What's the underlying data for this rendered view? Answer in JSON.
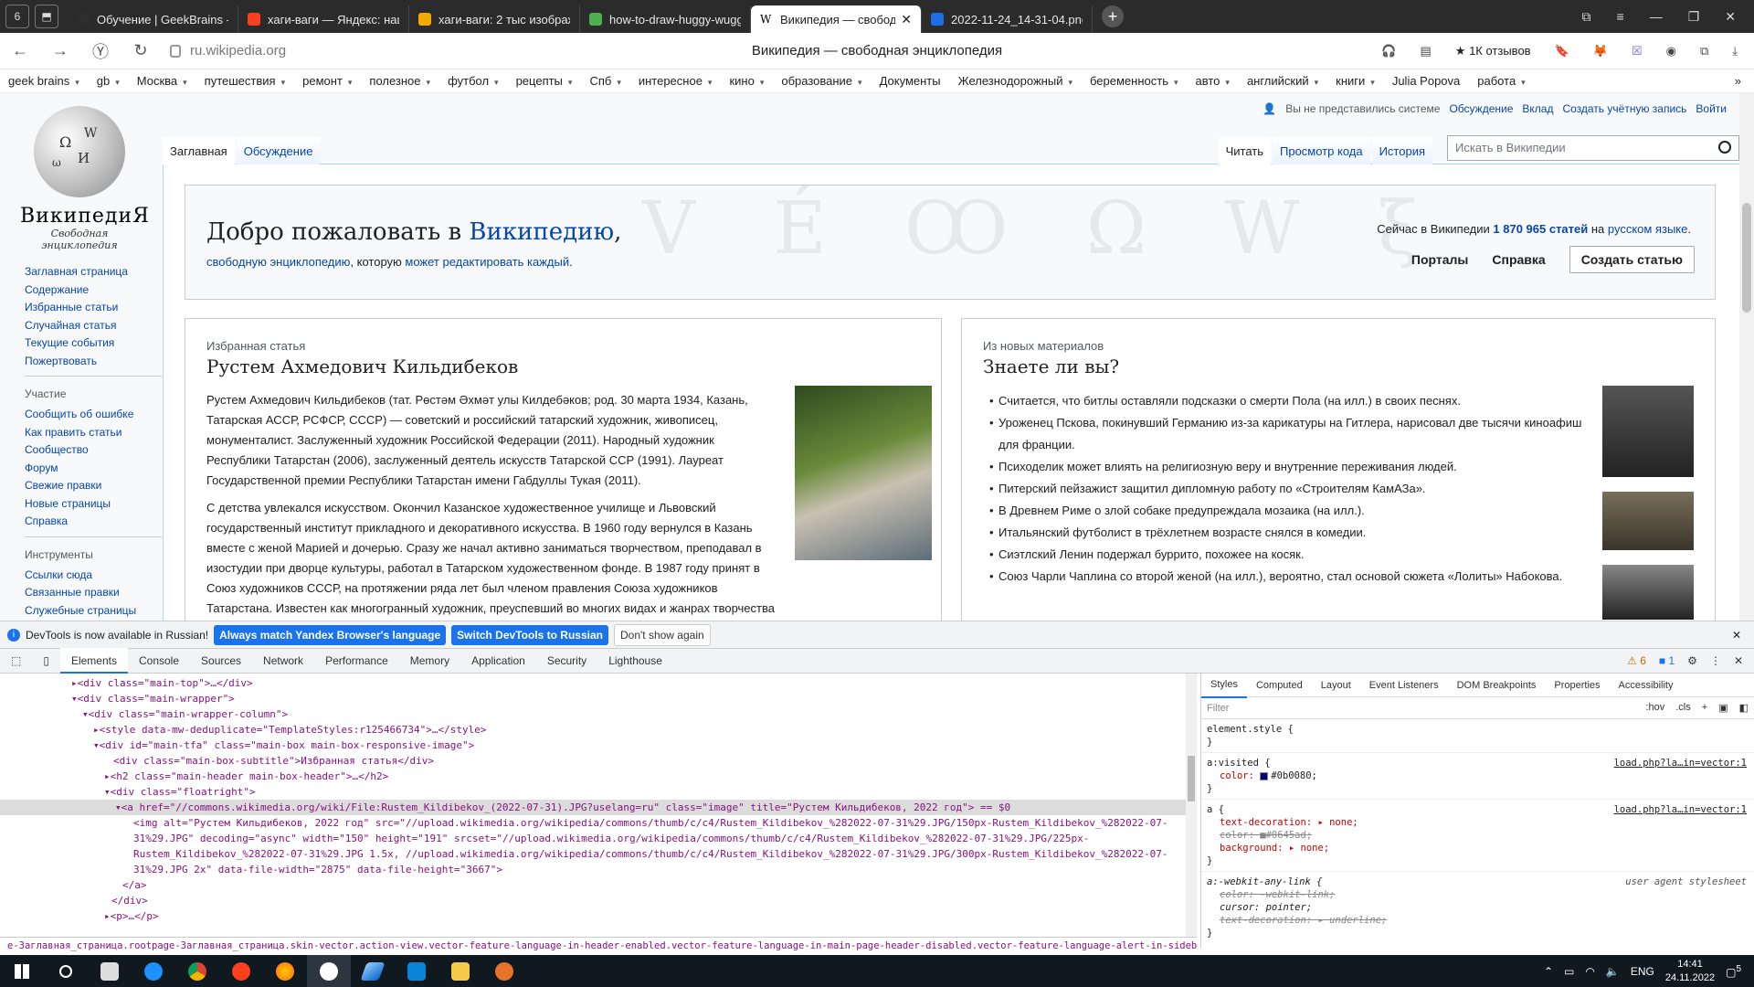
{
  "browser": {
    "tabs": [
      {
        "title": "Обучение | GeekBrains - о",
        "color": "#2e2e2e"
      },
      {
        "title": "хаги-ваги — Яндекс: нашл",
        "color": "#fc3f1d"
      },
      {
        "title": "хаги-ваги: 2 тыс изображ",
        "color": "#f2a900"
      },
      {
        "title": "how-to-draw-huggy-wugg",
        "color": "#4caf50"
      },
      {
        "title": "Википедия — свобод",
        "color": "#ffffff"
      },
      {
        "title": "2022-11-24_14-31-04.png",
        "color": "#1e6ee8"
      }
    ],
    "url": "ru.wikipedia.org",
    "page_title": "Википедия — свободная энциклопедия",
    "reviews": "1К отзывов",
    "bookmarks": [
      "geek brains",
      "gb",
      "Москва",
      "путешествия",
      "ремонт",
      "полезное",
      "футбол",
      "рецепты",
      "Спб",
      "интересное",
      "кино",
      "образование",
      "Документы",
      "Железнодорожный",
      "беременность",
      "авто",
      "английский",
      "книги",
      "Julia Popova",
      "работа"
    ],
    "bookmark_more": "»"
  },
  "wiki": {
    "wordmark": "ВикипедиЯ",
    "tagline": "Свободная энциклопедия",
    "nav": [
      "Заглавная страница",
      "Содержание",
      "Избранные статьи",
      "Случайная статья",
      "Текущие события",
      "Пожертвовать"
    ],
    "participation_heading": "Участие",
    "participation": [
      "Сообщить об ошибке",
      "Как править статьи",
      "Сообщество",
      "Форум",
      "Свежие правки",
      "Новые страницы",
      "Справка"
    ],
    "tools_heading": "Инструменты",
    "tools": [
      "Ссылки сюда",
      "Связанные правки",
      "Служебные страницы"
    ],
    "user": {
      "not_logged": "Вы не представились системе",
      "links": [
        "Обсуждение",
        "Вклад",
        "Создать учётную запись",
        "Войти"
      ]
    },
    "tabs_left": [
      "Заглавная",
      "Обсуждение"
    ],
    "tabs_right": [
      "Читать",
      "Просмотр кода",
      "История"
    ],
    "search_placeholder": "Искать в Википедии",
    "welcome": {
      "prefix": "Добро пожаловать в ",
      "link": "Википедию",
      "suffix": ",",
      "sub1": "свободную энциклопедию",
      "sub2": ", которую ",
      "sub3": "может редактировать каждый",
      "sub4": ".",
      "count_prefix": "Сейчас в Википедии ",
      "count_link": "1 870 965 статей",
      "count_mid": " на ",
      "count_lang": "русском языке",
      "count_suffix": ".",
      "portals": "Порталы",
      "help": "Справка",
      "create": "Создать статью",
      "deco": "V É Ꝏ Ω W ξ"
    },
    "featured": {
      "label": "Избранная статья",
      "title": "Рустем Ахмедович Кильдибеков",
      "p1": "Рустем Ахмедович Кильдибеков (тат. Рөстәм Әхмәт улы Килдебәков; род. 30 марта 1934, Казань, Татарская АССР, РСФСР, СССР) — советский и российский татарский художник, живописец, монументалист. Заслуженный художник Российской Федерации (2011). Народный художник Республики Татарстан (2006), заслуженный деятель искусств Татарской ССР (1991). Лауреат Государственной премии Республики Татарстан имени Габдуллы Тукая (2011).",
      "p2": "С детства увлекался искусством. Окончил Казанское художественное училище и Львовский государственный институт прикладного и декоративного искусства. В 1960 году вернулся в Казань вместе с женой Марией и дочерью. Сразу же начал активно заниматься творчеством, преподавал в изостудии при дворце культуры, работал в Татарском художественном фонде. В 1987 году принят в Союз художников СССР, на протяжении ряда лет был членом правления Союза художников Татарстана. Известен как многогранный художник, преуспевший во многих видах и жанрах творчества — в"
    },
    "dyk": {
      "label": "Из новых материалов",
      "title": "Знаете ли вы?",
      "items": [
        "Считается, что битлы оставляли подсказки о смерти Пола (на илл.) в своих песнях.",
        "Уроженец Пскова, покинувший Германию из-за карикатуры на Гитлера, нарисовал две тысячи киноафиш для франции.",
        "Психоделик может влиять на религиозную веру и внутренние переживания людей.",
        "Питерский пейзажист защитил дипломную работу по «Строителям КамАЗа».",
        "В Древнем Риме о злой собаке предупреждала мозаика (на илл.).",
        "Итальянский футболист в трёхлетнем возрасте снялся в комедии.",
        "Сиэтлский Ленин подержал буррито, похожее на косяк.",
        "Союз Чарли Чаплина со второй женой (на илл.), вероятно, стал основой сюжета «Лолиты» Набокова."
      ]
    }
  },
  "devtools": {
    "notice": "DevTools is now available in Russian!",
    "btn1": "Always match Yandex Browser's language",
    "btn2": "Switch DevTools to Russian",
    "btn3": "Don't show again",
    "tabs": [
      "Elements",
      "Console",
      "Sources",
      "Network",
      "Performance",
      "Memory",
      "Application",
      "Security",
      "Lighthouse"
    ],
    "warnings": "⚠ 6",
    "messages": "■ 1",
    "styles_tabs": [
      "Styles",
      "Computed",
      "Layout",
      "Event Listeners",
      "DOM Breakpoints",
      "Properties",
      "Accessibility"
    ],
    "filter": "Filter",
    "hov": ":hov",
    "cls": ".cls",
    "rule_element": "element.style {",
    "rule_visited": "a:visited {",
    "rule_visited_prop": "color:",
    "rule_visited_val": "#0b0080;",
    "rule_a": "a {",
    "rule_a_p1": "text-decoration: ▸ none;",
    "rule_a_p2": "color: ■#0645ad;",
    "rule_a_p3": "background: ▸ none;",
    "rule_any": "a:-webkit-any-link {",
    "rule_any_p1": "color: -webkit-link;",
    "rule_any_p2": "cursor: pointer;",
    "rule_any_p3": "text-decoration: ▸ underline;",
    "source": "load.php?la…in=vector:1",
    "ua": "user agent stylesheet",
    "close": "}",
    "breadcrumb": "e-Заглавная_страница.rootpage-Заглавная_страница.skin-vector.action-view.vector-feature-language-in-header-enabled.vector-feature-language-in-main-page-header-disabled.vector-feature-language-alert-in-sidebar-enabled.vector-feature-…",
    "dom": [
      "▸<div class=\"main-top\">…</div>",
      "▾<div class=\"main-wrapper\">",
      "▾<div class=\"main-wrapper-column\">",
      "▸<style data-mw-deduplicate=\"TemplateStyles:r125466734\">…</style>",
      "▾<div id=\"main-tfa\" class=\"main-box main-box-responsive-image\">",
      "<div class=\"main-box-subtitle\">Избранная статья</div>",
      "▸<h2 class=\"main-header main-box-header\">…</h2>",
      "▾<div class=\"floatright\">",
      "▾<a href=\"//commons.wikimedia.org/wiki/File:Rustem_Kildibekov_(2022-07-31).JPG?uselang=ru\" class=\"image\" title=\"Рустем Кильдибеков, 2022 год\"> == $0",
      "<img alt=\"Рустем Кильдибеков, 2022 год\" src=\"//upload.wikimedia.org/wikipedia/commons/thumb/c/c4/Rustem_Kildibekov_%282022-07-31%29.JPG/150px-Rustem_Kildibekov_%282022-07-31%29.JPG\" decoding=\"async\" width=\"150\" height=\"191\" srcset=\"//upload.wikimedia.org/wikipedia/commons/thumb/c/c4/Rustem_Kildibekov_%282022-07-31%29.JPG/225px-Rustem_Kildibekov_%282022-07-31%29.JPG 1.5x, //upload.wikimedia.org/wikipedia/commons/thumb/c/c4/Rustem_Kildibekov_%282022-07-31%29.JPG/300px-Rustem_Kildibekov_%282022-07-31%29.JPG 2x\" data-file-width=\"2875\" data-file-height=\"3667\">",
      "</a>",
      "</div>",
      "▸<p>…</p>"
    ]
  },
  "taskbar": {
    "lang": "ENG",
    "time": "14:41",
    "date": "24.11.2022",
    "notif": "5"
  }
}
